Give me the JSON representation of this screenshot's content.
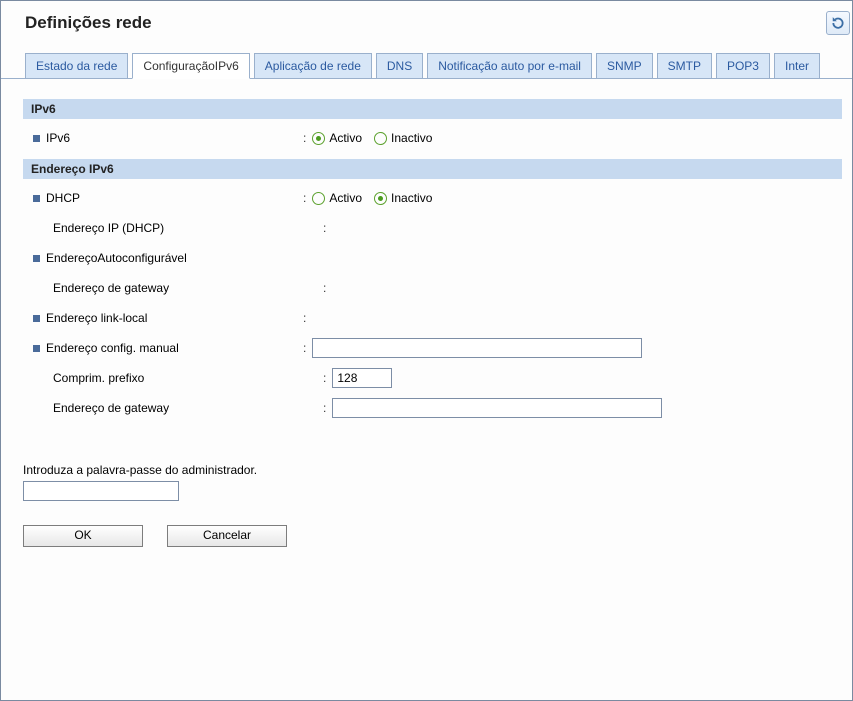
{
  "page": {
    "title": "Definições rede"
  },
  "tabs": [
    {
      "label": "Estado da rede",
      "active": false
    },
    {
      "label": "ConfiguraçãoIPv6",
      "active": true
    },
    {
      "label": "Aplicação de rede",
      "active": false
    },
    {
      "label": "DNS",
      "active": false
    },
    {
      "label": "Notificação auto por e-mail",
      "active": false
    },
    {
      "label": "SNMP",
      "active": false
    },
    {
      "label": "SMTP",
      "active": false
    },
    {
      "label": "POP3",
      "active": false
    },
    {
      "label": "Inter",
      "active": false
    }
  ],
  "radio_labels": {
    "active": "Activo",
    "inactive": "Inactivo"
  },
  "sections": {
    "ipv6": {
      "header": "IPv6",
      "ipv6_label": "IPv6",
      "ipv6_value": "active"
    },
    "addr": {
      "header": "Endereço IPv6",
      "dhcp_label": "DHCP",
      "dhcp_value": "inactive",
      "dhcp_ip_label": "Endereço IP (DHCP)",
      "dhcp_ip_value": "",
      "autoconf_label": "EndereçoAutoconfigurável",
      "autoconf_gateway_label": "Endereço de gateway",
      "autoconf_gateway_value": "",
      "linklocal_label": "Endereço link-local",
      "linklocal_value": "",
      "manual_label": "Endereço config. manual",
      "manual_value": "",
      "prefix_label": "Comprim. prefixo",
      "prefix_value": "128",
      "gateway_label": "Endereço de gateway",
      "gateway_value": ""
    }
  },
  "password": {
    "prompt": "Introduza a palavra-passe do administrador.",
    "value": ""
  },
  "buttons": {
    "ok": "OK",
    "cancel": "Cancelar"
  }
}
